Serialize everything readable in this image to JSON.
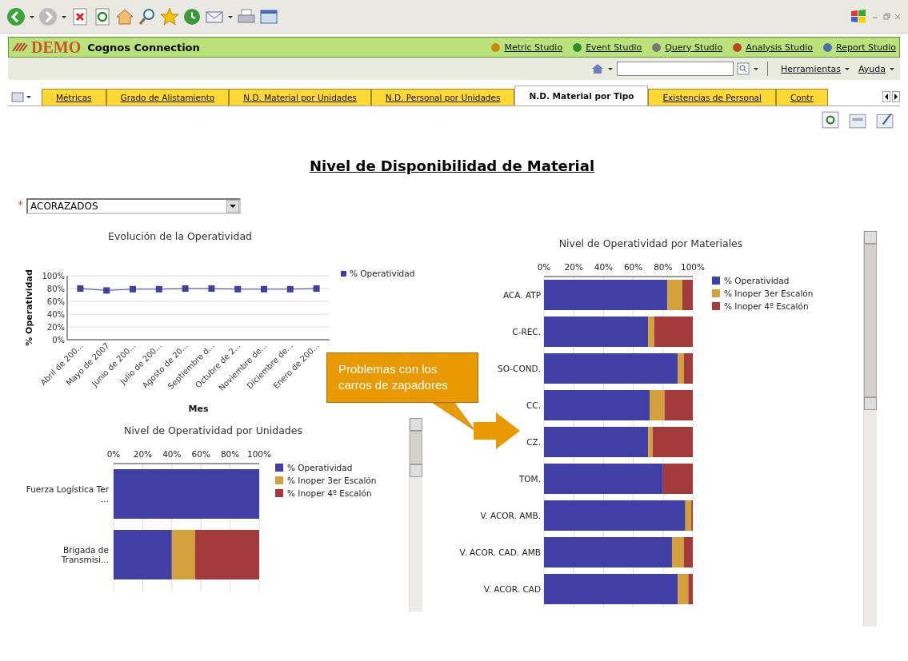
{
  "header": {
    "brand": "DEMO",
    "title": "Cognos Connection",
    "studio_links": [
      "Metric Studio",
      "Event Studio",
      "Query Studio",
      "Analysis Studio",
      "Report Studio"
    ]
  },
  "nav": {
    "menus": [
      "Herramientas",
      "Ayuda"
    ]
  },
  "tabs": [
    {
      "label": "Métricas",
      "selected": false
    },
    {
      "label": "Grado de Alistamiento",
      "selected": false
    },
    {
      "label": "N.D. Material por Unidades",
      "selected": false
    },
    {
      "label": "N.D. Personal por Unidades",
      "selected": false
    },
    {
      "label": "N.D. Material por Tipo",
      "selected": true
    },
    {
      "label": "Existencias de Personal",
      "selected": false
    },
    {
      "label": "Contr",
      "selected": false
    }
  ],
  "report": {
    "title": "Nivel de Disponibilidad de Material",
    "filter": {
      "required_mark": "*",
      "value": "ACORAZADOS"
    },
    "line_chart": {
      "title": "Evolución de la Operatividad",
      "chart_data": {
        "type": "line",
        "xlabel": "Mes",
        "ylabel": "% Operatividad",
        "grid": true,
        "legend": true,
        "categories": [
          "Abril de 200...",
          "Mayo de 2007",
          "Junio de 200...",
          "Julio de 200...",
          "Agosto de 20...",
          "Septiembre d...",
          "Octubre de 2...",
          "Noviembre de...",
          "Diciembre de...",
          "Enero de 200..."
        ],
        "series": [
          {
            "name": "% Operatividad",
            "color": "#3f3fa6",
            "marker": "square",
            "values": [
              80,
              77,
              79,
              79,
              80,
              80,
              79,
              79,
              79,
              80
            ]
          }
        ],
        "ylim": [
          0,
          100
        ],
        "yticks": [
          {
            "value": 0,
            "label": "0%"
          },
          {
            "value": 20,
            "label": "20%"
          },
          {
            "value": 40,
            "label": "40%"
          },
          {
            "value": 60,
            "label": "60%"
          },
          {
            "value": 80,
            "label": "80%"
          },
          {
            "value": 100,
            "label": "100%"
          }
        ]
      }
    },
    "units_chart": {
      "title": "Nivel de Operatividad por Unidades",
      "chart_data": {
        "type": "bar",
        "orientation": "horizontal",
        "stacked": true,
        "grid": true,
        "legend": true,
        "categories": [
          "Fuerza Logística Ter ...",
          "Brigada de Transmisi..."
        ],
        "series": [
          {
            "name": "% Operatividad",
            "color": "#3f3fa6",
            "values": [
              100,
              40
            ]
          },
          {
            "name": "% Inoper 3er Escalón",
            "color": "#d4a03c",
            "values": [
              0,
              16
            ]
          },
          {
            "name": "% Inoper 4º Escalón",
            "color": "#a33a3c",
            "values": [
              0,
              44
            ]
          }
        ],
        "xlim": [
          0,
          100
        ],
        "xticks": [
          {
            "value": 0,
            "label": "0%"
          },
          {
            "value": 20,
            "label": "20%"
          },
          {
            "value": 40,
            "label": "40%"
          },
          {
            "value": 60,
            "label": "60%"
          },
          {
            "value": 80,
            "label": "80%"
          },
          {
            "value": 100,
            "label": "100%"
          }
        ]
      }
    },
    "materials_chart": {
      "title": "Nivel de Operatividad por Materiales",
      "chart_data": {
        "type": "bar",
        "orientation": "horizontal",
        "stacked": true,
        "grid": true,
        "legend": true,
        "categories": [
          "ACA. ATP",
          "C-REC.",
          "SO-COND.",
          "CC.",
          "CZ.",
          "TOM.",
          "V. ACOR. AMB.",
          "V. ACOR. CAD. AMB",
          "V. ACOR. CAD"
        ],
        "series": [
          {
            "name": "% Operatividad",
            "color": "#3f3fa6",
            "values": [
              83,
              70,
              90,
              71,
              70,
              80,
              95,
              86,
              90
            ]
          },
          {
            "name": "% Inoper 3er Escalón",
            "color": "#d4a03c",
            "values": [
              10,
              4,
              4,
              10,
              3,
              0,
              4,
              8,
              7
            ]
          },
          {
            "name": "% Inoper 4º Escalón",
            "color": "#a33a3c",
            "values": [
              7,
              26,
              6,
              19,
              27,
              20,
              1,
              6,
              3
            ]
          }
        ],
        "xlim": [
          0,
          100
        ],
        "xticks": [
          {
            "value": 0,
            "label": "0%"
          },
          {
            "value": 20,
            "label": "20%"
          },
          {
            "value": 40,
            "label": "40%"
          },
          {
            "value": 60,
            "label": "60%"
          },
          {
            "value": 80,
            "label": "80%"
          },
          {
            "value": 100,
            "label": "100%"
          }
        ]
      }
    },
    "callout": "Problemas con los carros de zapadores"
  }
}
